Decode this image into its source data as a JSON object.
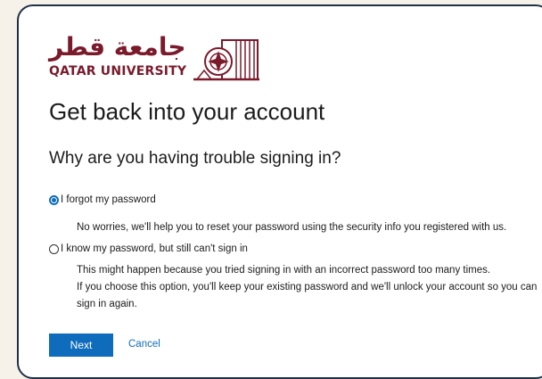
{
  "logo": {
    "arabic_text": "جامعة قطر",
    "english_text": "QATAR UNIVERSITY"
  },
  "heading": {
    "title": "Get back into your account",
    "subtitle": "Why are you having trouble signing in?"
  },
  "options": [
    {
      "label": "I forgot my password",
      "selected": true,
      "description": "No worries, we'll help you to reset your password using the security info you registered with us."
    },
    {
      "label": "I know my password, but still can't sign in",
      "selected": false,
      "description_line1": "This might happen because you tried signing in with an incorrect password too many times.",
      "description_line2": "If you choose this option, you'll keep your existing password and we'll unlock your account so you can sign in again."
    }
  ],
  "actions": {
    "next_label": "Next",
    "cancel_label": "Cancel"
  },
  "colors": {
    "brand_maroon": "#7a1a2b",
    "accent_blue": "#0f6cbd",
    "page_background": "#f6f1e9",
    "card_border": "#1f3146"
  }
}
